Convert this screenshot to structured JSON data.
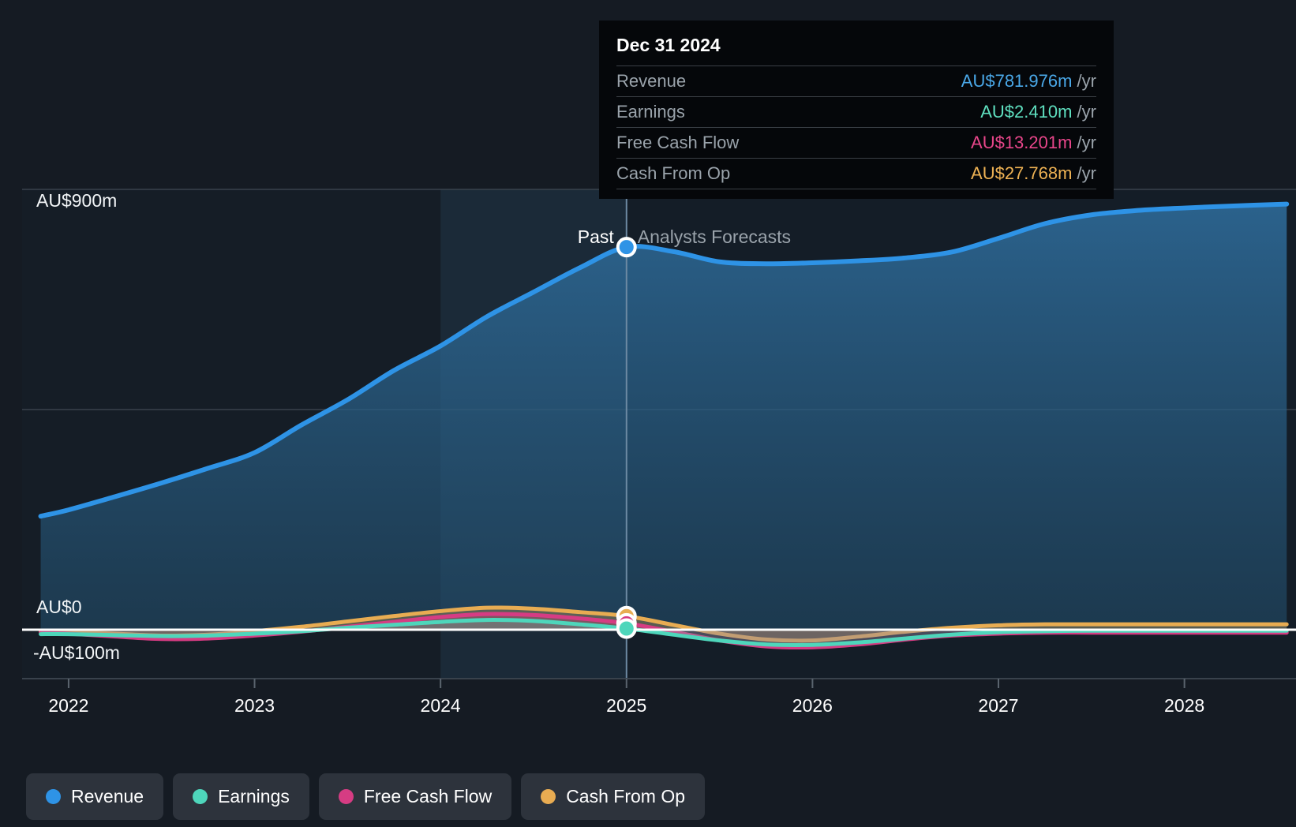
{
  "theme": {
    "background": "#151b23",
    "past_band": "#1b2a38",
    "forecast_band": "#141d27",
    "grid": "#39424c",
    "zero_line": "#ffffff",
    "tooltip_bg": "#05070a",
    "muted_text": "#9aa3ab"
  },
  "tooltip": {
    "title": "Dec 31 2024",
    "rows": [
      {
        "label": "Revenue",
        "value": "AU$781.976m",
        "unit": "/yr",
        "color": "#4aa8e8"
      },
      {
        "label": "Earnings",
        "value": "AU$2.410m",
        "unit": "/yr",
        "color": "#5fe0c0"
      },
      {
        "label": "Free Cash Flow",
        "value": "AU$13.201m",
        "unit": "/yr",
        "color": "#e8468a"
      },
      {
        "label": "Cash From Op",
        "value": "AU$27.768m",
        "unit": "/yr",
        "color": "#eeb254"
      }
    ]
  },
  "period_markers": {
    "past_label": "Past",
    "forecast_label": "Analysts Forecasts",
    "divider_year": 2025
  },
  "legend": {
    "items": [
      {
        "label": "Revenue",
        "color": "#2e93e6"
      },
      {
        "label": "Earnings",
        "color": "#4ed6bb"
      },
      {
        "label": "Free Cash Flow",
        "color": "#d63c83"
      },
      {
        "label": "Cash From Op",
        "color": "#e8ac52"
      }
    ]
  },
  "chart_data": {
    "type": "area",
    "title": "",
    "xlabel": "",
    "ylabel": "",
    "grid": true,
    "legend_position": "bottom-left",
    "y_axis": {
      "labels": [
        "AU$900m",
        "AU$0",
        "-AU$100m"
      ],
      "values": [
        900,
        0,
        -100
      ],
      "ylim": [
        -100,
        900
      ],
      "gridlines": [
        900,
        450,
        0
      ]
    },
    "x_axis": {
      "tick_labels": [
        "2022",
        "2023",
        "2024",
        "2025",
        "2026",
        "2027",
        "2028"
      ],
      "tick_values": [
        2022,
        2023,
        2024,
        2025,
        2026,
        2027,
        2028
      ],
      "xlim": [
        2021.75,
        2028.6
      ]
    },
    "highlight": {
      "x": 2025.0,
      "date": "Dec 31 2024",
      "points": [
        {
          "series": "Revenue",
          "y": 781.976,
          "color": "#2e93e6"
        },
        {
          "series": "Cash From Op",
          "y": 27.768,
          "color": "#e8ac52"
        },
        {
          "series": "Free Cash Flow",
          "y": 13.201,
          "color": "#d63c83"
        },
        {
          "series": "Earnings",
          "y": 2.41,
          "color": "#4ed6bb"
        }
      ]
    },
    "x": [
      2021.85,
      2022.0,
      2022.25,
      2022.5,
      2022.75,
      2023.0,
      2023.25,
      2023.5,
      2023.75,
      2024.0,
      2024.25,
      2024.5,
      2024.75,
      2025.0,
      2025.25,
      2025.5,
      2025.75,
      2026.0,
      2026.25,
      2026.5,
      2026.75,
      2027.0,
      2027.25,
      2027.5,
      2027.75,
      2028.0,
      2028.25,
      2028.55
    ],
    "series": [
      {
        "name": "Revenue",
        "color": "#2e93e6",
        "fill": "rgba(44,110,160,0.40)",
        "values": [
          232,
          245,
          272,
          300,
          330,
          362,
          418,
          470,
          530,
          580,
          640,
          690,
          740,
          781.976,
          773,
          752,
          748,
          750,
          754,
          760,
          772,
          800,
          830,
          848,
          857,
          862,
          866,
          870
        ]
      },
      {
        "name": "Earnings",
        "color": "#4ed6bb",
        "fill": "rgba(78,214,187,0.22)",
        "values": [
          -9,
          -9,
          -11,
          -13,
          -12,
          -8,
          -3,
          4,
          10,
          16,
          20,
          18,
          11,
          2.41,
          -10,
          -22,
          -30,
          -31,
          -26,
          -18,
          -10,
          -5,
          -3,
          -2,
          -2,
          -2,
          -2,
          -2
        ]
      },
      {
        "name": "Free Cash Flow",
        "color": "#d63c83",
        "fill": "rgba(214,60,131,0.28)",
        "values": [
          -6,
          -8,
          -14,
          -19,
          -18,
          -12,
          -4,
          6,
          16,
          26,
          32,
          30,
          23,
          13.201,
          -4,
          -22,
          -34,
          -36,
          -30,
          -20,
          -12,
          -8,
          -6,
          -6,
          -6,
          -6,
          -6,
          -6
        ]
      },
      {
        "name": "Cash From Op",
        "color": "#e8ac52",
        "fill": "rgba(232,172,82,0.30)",
        "values": [
          -3,
          -4,
          -8,
          -12,
          -10,
          -3,
          6,
          17,
          28,
          38,
          45,
          43,
          36,
          27.768,
          10,
          -8,
          -20,
          -22,
          -14,
          -4,
          4,
          9,
          11,
          11,
          11,
          11,
          11,
          11
        ]
      }
    ]
  }
}
